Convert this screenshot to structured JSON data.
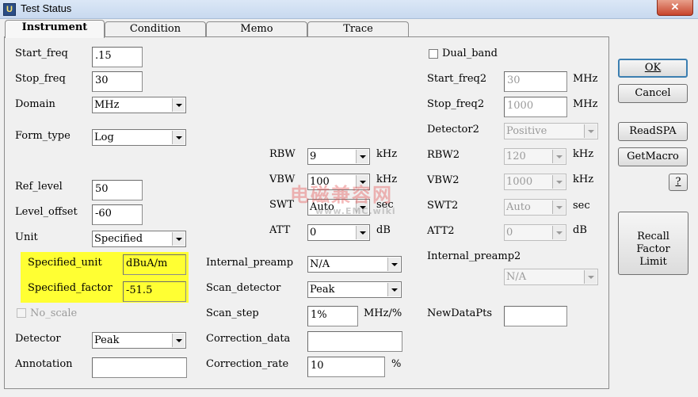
{
  "window": {
    "title": "Test Status",
    "close_symbol": "✕"
  },
  "tabs": [
    "Instrument",
    "Condition",
    "Memo",
    "Trace"
  ],
  "left": {
    "start_freq_label": "Start_freq",
    "start_freq_value": ".15",
    "stop_freq_label": "Stop_freq",
    "stop_freq_value": "30",
    "domain_label": "Domain",
    "domain_value": "MHz",
    "form_type_label": "Form_type",
    "form_type_value": "Log",
    "ref_level_label": "Ref_level",
    "ref_level_value": "50",
    "level_offset_label": "Level_offset",
    "level_offset_value": "-60",
    "unit_label": "Unit",
    "unit_value": "Specified",
    "specified_unit_label": "Specified_unit",
    "specified_unit_value": "dBuA/m",
    "specified_factor_label": "Specified_factor",
    "specified_factor_value": "-51.5",
    "no_scale_label": "No_scale",
    "detector_label": "Detector",
    "detector_value": "Peak",
    "annotation_label": "Annotation",
    "annotation_value": ""
  },
  "middle": {
    "rbw_label": "RBW",
    "rbw_value": "9",
    "rbw_unit": "kHz",
    "vbw_label": "VBW",
    "vbw_value": "100",
    "vbw_unit": "kHz",
    "swt_label": "SWT",
    "swt_value": "Auto",
    "swt_unit": "sec",
    "att_label": "ATT",
    "att_value": "0",
    "att_unit": "dB",
    "internal_preamp_label": "Internal_preamp",
    "internal_preamp_value": "N/A",
    "scan_detector_label": "Scan_detector",
    "scan_detector_value": "Peak",
    "scan_step_label": "Scan_step",
    "scan_step_value": "1%",
    "scan_step_unit": "MHz/%",
    "correction_data_label": "Correction_data",
    "correction_data_value": "",
    "correction_rate_label": "Correction_rate",
    "correction_rate_value": "10",
    "correction_rate_unit": "%"
  },
  "right": {
    "dual_band_label": "Dual_band",
    "start_freq2_label": "Start_freq2",
    "start_freq2_value": "30",
    "start_freq2_unit": "MHz",
    "stop_freq2_label": "Stop_freq2",
    "stop_freq2_value": "1000",
    "stop_freq2_unit": "MHz",
    "detector2_label": "Detector2",
    "detector2_value": "Positive",
    "rbw2_label": "RBW2",
    "rbw2_value": "120",
    "rbw2_unit": "kHz",
    "vbw2_label": "VBW2",
    "vbw2_value": "1000",
    "vbw2_unit": "kHz",
    "swt2_label": "SWT2",
    "swt2_value": "Auto",
    "swt2_unit": "sec",
    "att2_label": "ATT2",
    "att2_value": "0",
    "att2_unit": "dB",
    "internal_preamp2_label": "Internal_preamp2",
    "internal_preamp2_value": "N/A",
    "new_data_pts_label": "NewDataPts",
    "new_data_pts_value": ""
  },
  "buttons": {
    "ok": "OK",
    "cancel": "Cancel",
    "read_spa": "ReadSPA",
    "get_macro": "GetMacro",
    "help": "?",
    "recall_line1": "Recall Factor",
    "recall_line2": "Limit"
  },
  "watermark": {
    "line1": "电磁兼容网",
    "line2": "www.EMC.wiki"
  },
  "colors": {
    "highlight": "#ffff33",
    "title_bar": "#dbe7f6",
    "close_button": "#c8452c"
  }
}
